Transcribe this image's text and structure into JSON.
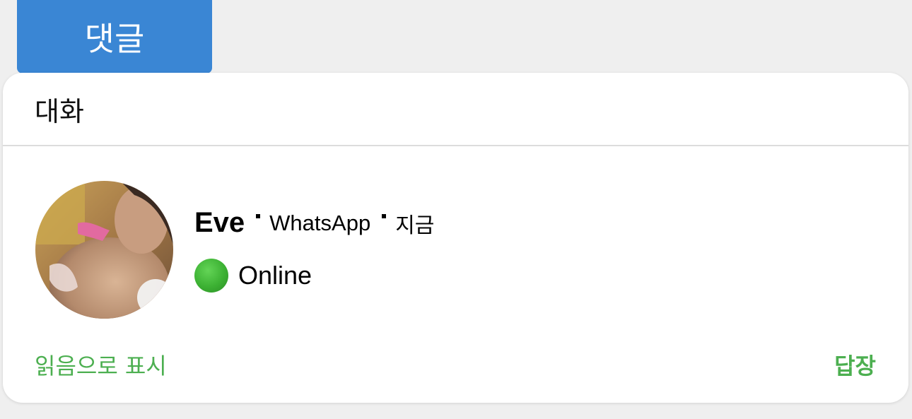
{
  "top_tab": {
    "label": "댓글"
  },
  "card": {
    "title": "대화",
    "notification": {
      "sender": "Eve",
      "app": "WhatsApp",
      "time": "지금",
      "status": "Online",
      "status_color": "#3cb133"
    },
    "actions": {
      "mark_read": "읽음으로 표시",
      "reply": "답장"
    }
  },
  "colors": {
    "accent_blue": "#3a86d4",
    "action_green": "#4caf50",
    "background": "#efefef"
  }
}
